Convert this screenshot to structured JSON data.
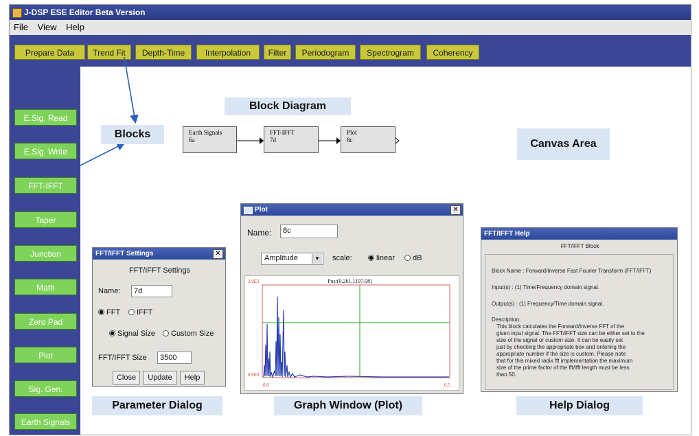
{
  "window": {
    "title": "J-DSP ESE Editor Beta Version"
  },
  "menu": [
    "File",
    "View",
    "Help"
  ],
  "toolbar": [
    "Prepare Data",
    "Trend Fit",
    "Depth-Time",
    "Interpolation",
    "Filter",
    "Periodogram",
    "Spectrogram",
    "Coherency"
  ],
  "sidebar": [
    "E.Sig. Read",
    "E.Sig. Write",
    "FFT-IFFT",
    "Taper",
    "Junction",
    "Math",
    "Zero Pad",
    "Plot",
    "Sig. Gen.",
    "Earth Signals"
  ],
  "annotations": {
    "block_diagram": "Block Diagram",
    "blocks": "Blocks",
    "canvas_area": "Canvas Area",
    "parameter_dialog": "Parameter Dialog",
    "graph_window": "Graph Window (Plot)",
    "help_dialog": "Help Dialog"
  },
  "diagram_blocks": [
    {
      "name": "Earth Signals",
      "id": "6a"
    },
    {
      "name": "FFT-IFFT",
      "id": "7d"
    },
    {
      "name": "Plot",
      "id": "8c"
    }
  ],
  "settings_dialog": {
    "title": "FFT/IFFT Settings",
    "heading": "FFT/IFFT Settings",
    "name_label": "Name:",
    "name_value": "7d",
    "fft_label": "FFT",
    "ifft_label": "IFFT",
    "signal_size_label": "Signal Size",
    "custom_size_label": "Custom Size",
    "size_label": "FFT/IFFT Size",
    "size_value": "3500",
    "close": "Close",
    "update": "Update",
    "help": "Help"
  },
  "plot_window": {
    "title": "Plot",
    "name_label": "Name:",
    "name_value": "8c",
    "dropdown_value": "Amplitude",
    "scale_label": "scale:",
    "linear_label": "linear",
    "db_label": "dB",
    "pos_readout": "Pos:(0.261,1197.08)",
    "y_max_label": "2.0E3",
    "y_min_label": "0.0E0",
    "x_min_label": "0.0",
    "x_max_label": "0.5"
  },
  "help_dialog": {
    "title": "FFT/IFFT Help",
    "heading": "FFT/IFFT Block",
    "block_name": "Block Name : Forward/Inverse Fast Fourier Transform (FFT/IFFT)",
    "inputs": "Input(s)  :  (1) Time/Frequency domain signal.",
    "outputs": "Output(s)  :  (1) Frequency/Time domain signal.",
    "description_label": "Description:",
    "description_lines": [
      "This block calculates the Forward/Inverse FFT of the",
      "given input signal. The FFT/IFFT size can be either set to the",
      "size of the signal or custom size. It can be easily set",
      "just by checking the appropriate box and entering the",
      "appropriate number if the size is custom. Please note",
      "that for this mixed radix fft implementation the maximum",
      "size of the prime factor of the fft/ifft length must be less",
      "than 50."
    ]
  },
  "colors": {
    "toolbar_bg": "#3b4796",
    "tool_button": "#c8c83a",
    "side_button": "#7fd35a",
    "annotation_bg": "#dbe6f5",
    "plot_signal": "#2840b0",
    "plot_cursor": "#22aa22",
    "plot_border": "#e05a5a"
  }
}
